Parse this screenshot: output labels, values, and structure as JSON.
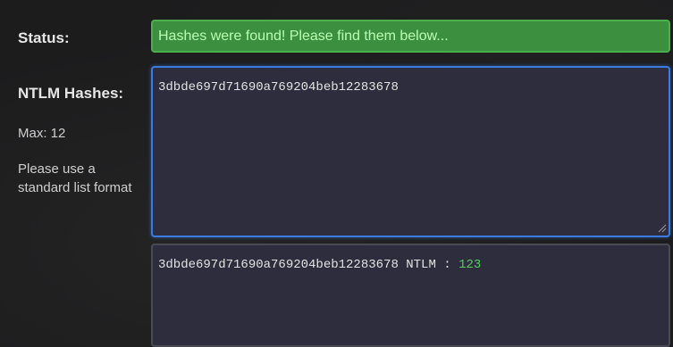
{
  "status": {
    "label": "Status:",
    "message": "Hashes were found! Please find them below..."
  },
  "ntlm": {
    "label": "NTLM Hashes:",
    "max": "Max: 12",
    "hint_line1": "Please use a",
    "hint_line2": "standard list format",
    "input_value": "3dbde697d71690a769204beb12283678"
  },
  "results": {
    "hash": "3dbde697d71690a769204beb12283678",
    "type_sep": " NTLM : ",
    "password": "123"
  },
  "colors": {
    "status_bg": "#3c8f3f",
    "status_text": "#b8ffb0",
    "focus_border": "#3b7be0",
    "password": "#55d060"
  }
}
